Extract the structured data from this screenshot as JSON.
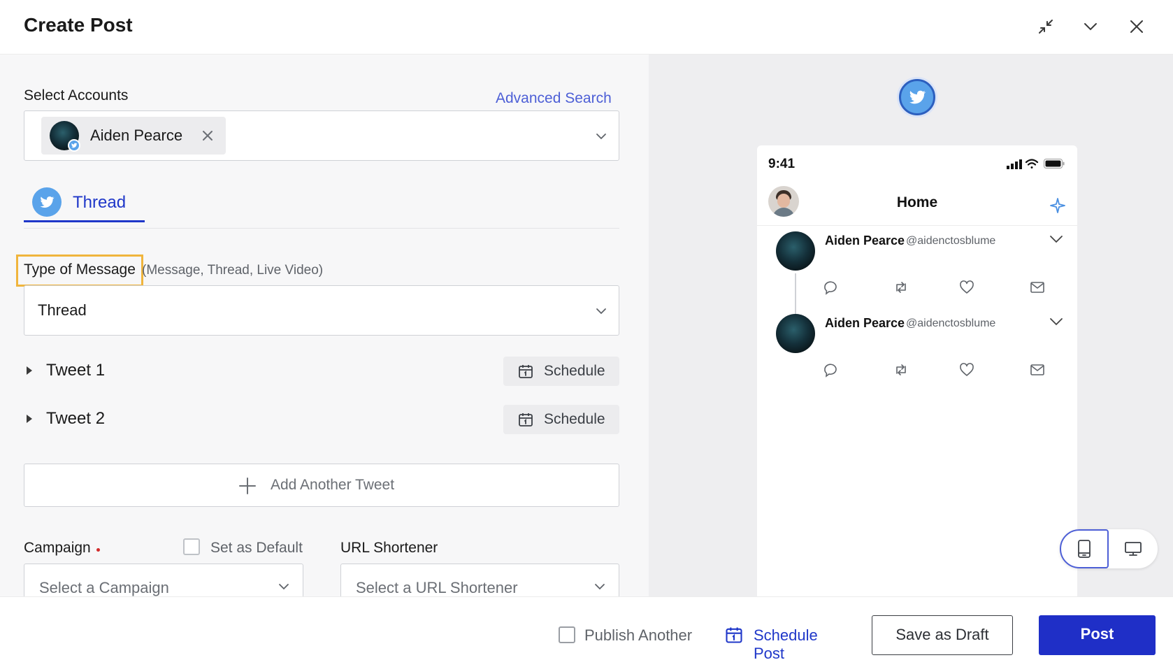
{
  "header": {
    "title": "Create Post"
  },
  "accounts": {
    "label": "Select Accounts",
    "advanced_search": "Advanced Search",
    "selected": [
      {
        "name": "Aiden Pearce"
      }
    ]
  },
  "tabs": [
    {
      "label": "Thread",
      "active": true,
      "icon": "twitter-icon"
    }
  ],
  "message_type": {
    "label": "Type of Message",
    "hint": "(Message, Thread, Live Video)",
    "value": "Thread"
  },
  "tweets": [
    {
      "label": "Tweet 1",
      "schedule_label": "Schedule"
    },
    {
      "label": "Tweet 2",
      "schedule_label": "Schedule"
    }
  ],
  "add_tweet_label": "Add Another Tweet",
  "campaign": {
    "label": "Campaign",
    "required": true,
    "set_default_label": "Set as Default",
    "placeholder": "Select a Campaign"
  },
  "url_shortener": {
    "label": "URL Shortener",
    "placeholder": "Select a URL Shortener"
  },
  "preview": {
    "status_time": "9:41",
    "feed_title": "Home",
    "posts": [
      {
        "name": "Aiden Pearce",
        "handle": "@aidenctosblume"
      },
      {
        "name": "Aiden Pearce",
        "handle": "@aidenctosblume"
      }
    ],
    "view_mode": "mobile"
  },
  "footer": {
    "publish_another_label": "Publish Another",
    "schedule_post_label": "Schedule Post",
    "save_draft_label": "Save as Draft",
    "post_label": "Post"
  },
  "colors": {
    "primary": "#1f2fc7",
    "link": "#4d5fd6",
    "twitter": "#5aa3ea",
    "highlight": "#f0b53d",
    "required": "#d22b2b"
  }
}
